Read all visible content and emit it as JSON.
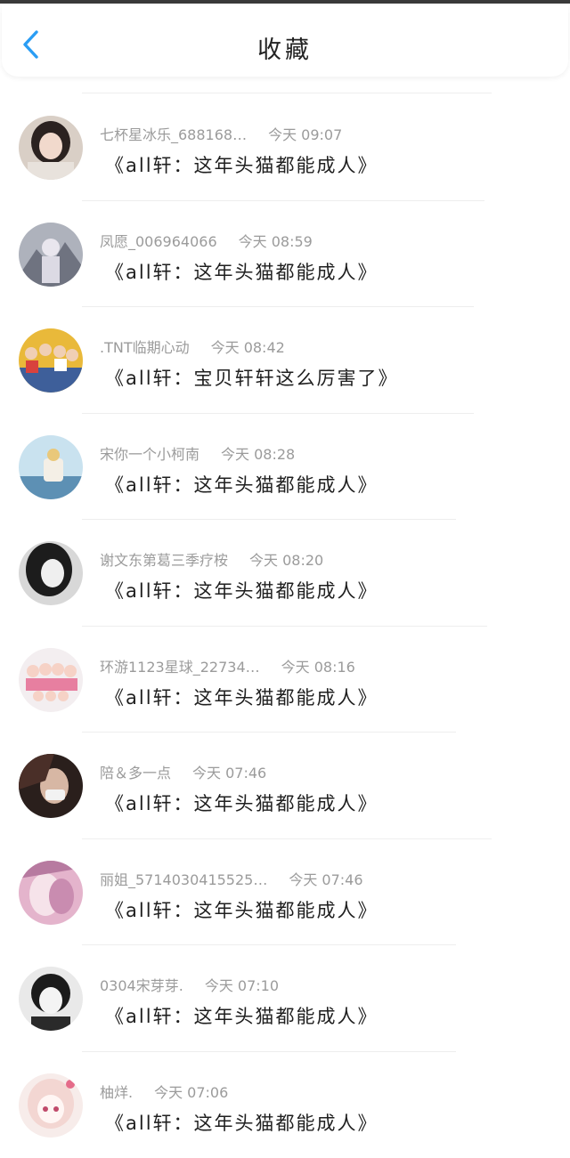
{
  "header": {
    "title": "收藏",
    "back_icon": "chevron-left-icon",
    "accent_color": "#2a9df4"
  },
  "items": [
    {
      "user": "七杯星冰乐_688168…",
      "time": "今天 09:07",
      "title": "《all轩：这年头猫都能成人》"
    },
    {
      "user": "凤愿_006964066",
      "time": "今天 08:59",
      "title": "《all轩：这年头猫都能成人》"
    },
    {
      "user": ".TNT临期心动",
      "time": "今天 08:42",
      "title": "《all轩：宝贝轩轩这么厉害了》"
    },
    {
      "user": "宋你一个小柯南",
      "time": "今天 08:28",
      "title": "《all轩：这年头猫都能成人》"
    },
    {
      "user": "谢文东第葛三季疗桉",
      "time": "今天 08:20",
      "title": "《all轩：这年头猫都能成人》"
    },
    {
      "user": "环游1123星球_22734…",
      "time": "今天 08:16",
      "title": "《all轩：这年头猫都能成人》"
    },
    {
      "user": "陪＆多一点",
      "time": "今天 07:46",
      "title": "《all轩：这年头猫都能成人》"
    },
    {
      "user": "丽姐_5714030415525…",
      "time": "今天 07:46",
      "title": "《all轩：这年头猫都能成人》"
    },
    {
      "user": "0304宋芽芽.",
      "time": "今天 07:10",
      "title": "《all轩：这年头猫都能成人》"
    },
    {
      "user": "柚烊.",
      "time": "今天 07:06",
      "title": "《all轩：这年头猫都能成人》"
    }
  ]
}
